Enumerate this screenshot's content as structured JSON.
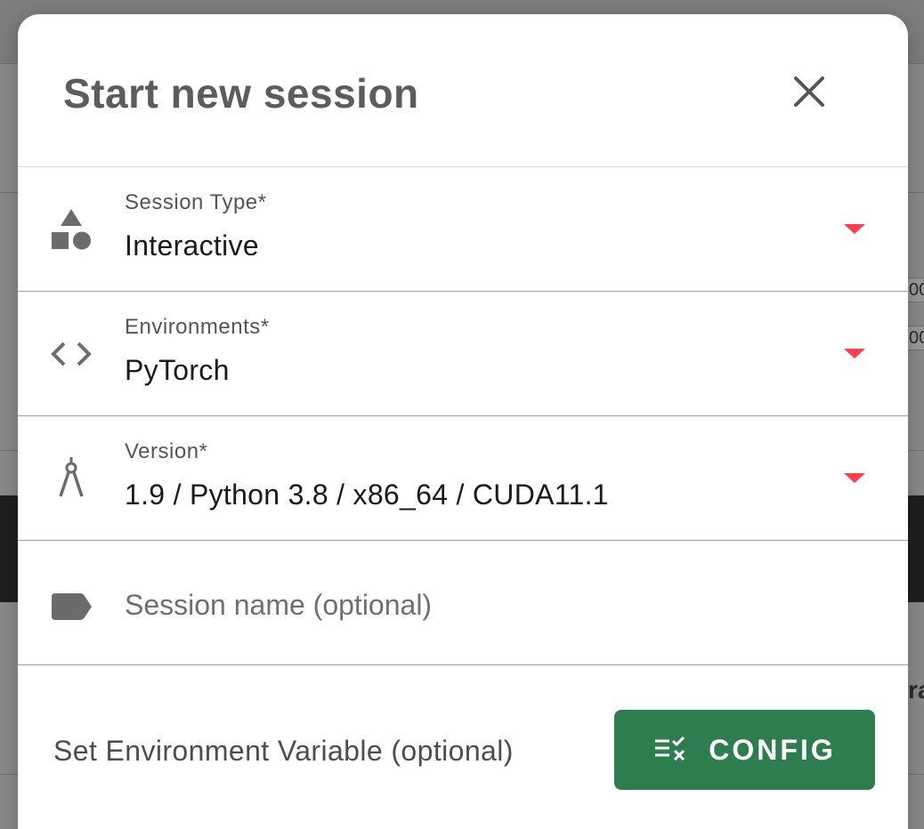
{
  "dialog": {
    "title": "Start new session",
    "close_icon": "close-icon"
  },
  "fields": {
    "session_type": {
      "label": "Session Type*",
      "value": "Interactive",
      "icon": "shapes-icon"
    },
    "environments": {
      "label": "Environments*",
      "value": "PyTorch",
      "icon": "code-icon"
    },
    "version": {
      "label": "Version*",
      "value": "1.9 / Python 3.8 / x86_64 / CUDA11.1",
      "icon": "compass-icon"
    },
    "session_name": {
      "placeholder": "Session name (optional)",
      "value": "",
      "icon": "label-tag-icon"
    }
  },
  "env_variable": {
    "label": "Set Environment Variable (optional)",
    "button_label": "CONFIG",
    "button_icon": "rule-icon"
  },
  "colors": {
    "accent_arrow": "#ff3d4e",
    "config_button": "#2e7d4f",
    "title_text": "#5c5c5c"
  },
  "background": {
    "cell_1_text": "00",
    "cell_2_text": "00",
    "side_text": "ra"
  }
}
